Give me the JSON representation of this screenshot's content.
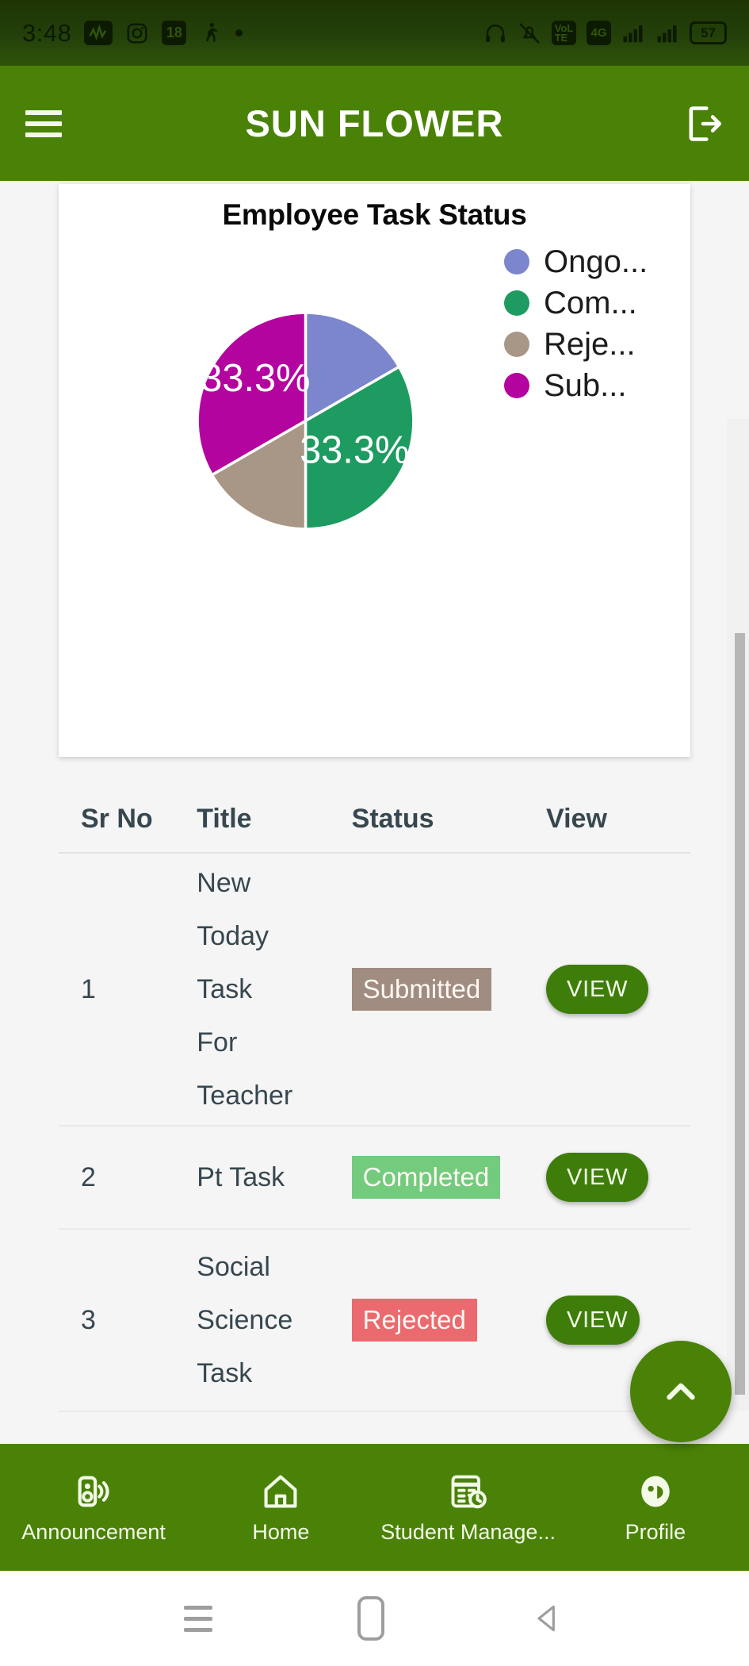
{
  "status_bar": {
    "time": "3:48",
    "icons_left": [
      "music-badge-icon",
      "instagram-icon",
      "notification-count-badge",
      "walking-person-icon",
      "dot-icon"
    ],
    "badge_count": "18",
    "icons_right": [
      "headphones-icon",
      "vibrate-off-icon",
      "volte-icon",
      "4g-icon",
      "signal-bars-icon",
      "signal-bars-2-icon"
    ],
    "battery": "57"
  },
  "app_bar": {
    "title": "SUN FLOWER",
    "menu_icon": "hamburger-menu-icon",
    "logout_icon": "logout-icon"
  },
  "chart_data": {
    "type": "pie",
    "title": "Employee Task Status",
    "categories": [
      "Ongo...",
      "Com...",
      "Reje...",
      "Sub..."
    ],
    "full_categories": [
      "Ongoing",
      "Completed",
      "Rejected",
      "Submitted"
    ],
    "values": [
      16.7,
      33.3,
      16.7,
      33.3
    ],
    "labels": [
      "",
      "33.3%",
      "",
      "33.3%"
    ],
    "colors": [
      "#7b86cc",
      "#1e9b60",
      "#a89787",
      "#b4049f"
    ],
    "legend_position": "right",
    "grid": false
  },
  "table": {
    "headers": [
      "Sr No",
      "Title",
      "Status",
      "View"
    ],
    "rows": [
      {
        "sr": "1",
        "title": "New\nToday\nTask\nFor\nTeacher",
        "status": "Submitted",
        "status_kind": "submitted",
        "view_label": "VIEW"
      },
      {
        "sr": "2",
        "title": "Pt Task",
        "status": "Completed",
        "status_kind": "completed",
        "view_label": "VIEW"
      },
      {
        "sr": "3",
        "title": "Social\nScience\nTask",
        "status": "Rejected",
        "status_kind": "rejected",
        "view_label": "VIEW"
      }
    ]
  },
  "fab": {
    "icon": "chevron-up-icon"
  },
  "bottom_nav": {
    "items": [
      {
        "label": "Announcement",
        "icon": "megaphone-icon"
      },
      {
        "label": "Home",
        "icon": "home-icon"
      },
      {
        "label": "Student Manage...",
        "icon": "calendar-clock-icon"
      },
      {
        "label": "Profile",
        "icon": "profile-face-icon"
      }
    ]
  },
  "android_nav": {
    "recents": "recents-icon",
    "home": "home-pill-icon",
    "back": "back-triangle-icon"
  },
  "colors": {
    "brand_green": "#4a8207",
    "status_bar_green": "#23400a",
    "view_button": "#3f7d0b"
  }
}
